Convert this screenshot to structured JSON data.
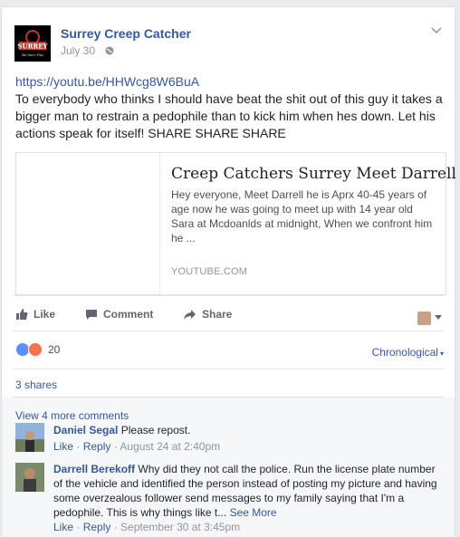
{
  "post": {
    "page_name": "Surrey Creep Catcher",
    "logo_text": "SURREY",
    "logo_subtext": "We Don't Play",
    "date": "July 30",
    "link_url": "https://youtu.be/HHWcg8W6BuA",
    "body": "To everybody who thinks I should have beat the shit out of this guy it takes a bigger man to restrain a pedophile than to kick him when hes down. Let his actions speak for itself! SHARE SHARE SHARE"
  },
  "link_preview": {
    "title": "Creep Catchers Surrey Meet Darrell",
    "description": "Hey everyone, Meet Darrell he is Aprx 40-45 years of age now he was going to meet up with 14 year old Sara at Mcdoanlds at midnight, When we confront him he ...",
    "domain": "YOUTUBE.COM"
  },
  "actions": {
    "like": "Like",
    "comment": "Comment",
    "share": "Share"
  },
  "reactions": {
    "count": "20",
    "sort": "Chronological"
  },
  "shares": "3 shares",
  "view_more": "View 4 more comments",
  "comments": [
    {
      "name": "Daniel Segal",
      "text": "Please repost.",
      "like": "Like",
      "reply": "Reply",
      "time": "August 24 at 2:40pm"
    },
    {
      "name": "Darrell Berekoff",
      "text": "Why did they not call the police. Run the license plate number of the vehicle and identified the person instead of posting my picture and having some overzealous follower send messages to my family saying that I'm a pedophile. This is why things like t...",
      "see_more": "See More",
      "like": "Like",
      "reply": "Reply",
      "time": "September 30 at 3:45pm"
    }
  ],
  "colors": {
    "link": "#365899",
    "like_reaction": "#5890ff",
    "angry_reaction": "#f7714b"
  }
}
